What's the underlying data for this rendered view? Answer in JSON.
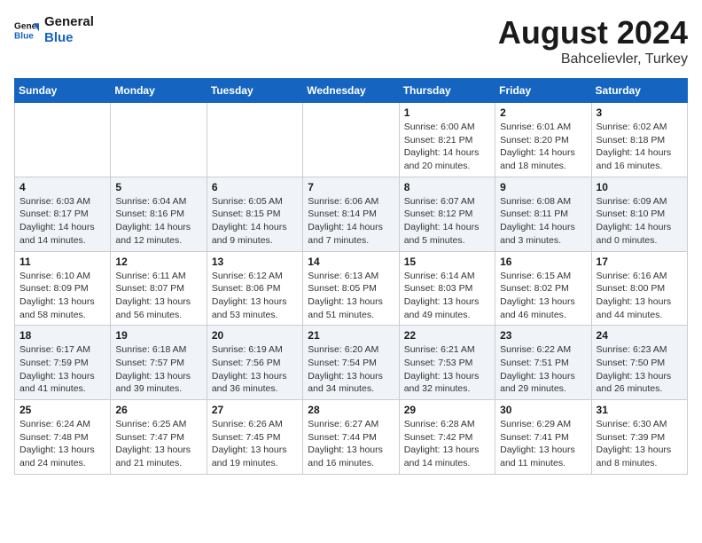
{
  "header": {
    "logo_line1": "General",
    "logo_line2": "Blue",
    "main_title": "August 2024",
    "subtitle": "Bahcelievler, Turkey"
  },
  "calendar": {
    "days_of_week": [
      "Sunday",
      "Monday",
      "Tuesday",
      "Wednesday",
      "Thursday",
      "Friday",
      "Saturday"
    ],
    "weeks": [
      {
        "days": [
          {
            "num": "",
            "detail": ""
          },
          {
            "num": "",
            "detail": ""
          },
          {
            "num": "",
            "detail": ""
          },
          {
            "num": "",
            "detail": ""
          },
          {
            "num": "1",
            "detail": "Sunrise: 6:00 AM\nSunset: 8:21 PM\nDaylight: 14 hours and 20 minutes."
          },
          {
            "num": "2",
            "detail": "Sunrise: 6:01 AM\nSunset: 8:20 PM\nDaylight: 14 hours and 18 minutes."
          },
          {
            "num": "3",
            "detail": "Sunrise: 6:02 AM\nSunset: 8:18 PM\nDaylight: 14 hours and 16 minutes."
          }
        ]
      },
      {
        "days": [
          {
            "num": "4",
            "detail": "Sunrise: 6:03 AM\nSunset: 8:17 PM\nDaylight: 14 hours and 14 minutes."
          },
          {
            "num": "5",
            "detail": "Sunrise: 6:04 AM\nSunset: 8:16 PM\nDaylight: 14 hours and 12 minutes."
          },
          {
            "num": "6",
            "detail": "Sunrise: 6:05 AM\nSunset: 8:15 PM\nDaylight: 14 hours and 9 minutes."
          },
          {
            "num": "7",
            "detail": "Sunrise: 6:06 AM\nSunset: 8:14 PM\nDaylight: 14 hours and 7 minutes."
          },
          {
            "num": "8",
            "detail": "Sunrise: 6:07 AM\nSunset: 8:12 PM\nDaylight: 14 hours and 5 minutes."
          },
          {
            "num": "9",
            "detail": "Sunrise: 6:08 AM\nSunset: 8:11 PM\nDaylight: 14 hours and 3 minutes."
          },
          {
            "num": "10",
            "detail": "Sunrise: 6:09 AM\nSunset: 8:10 PM\nDaylight: 14 hours and 0 minutes."
          }
        ]
      },
      {
        "days": [
          {
            "num": "11",
            "detail": "Sunrise: 6:10 AM\nSunset: 8:09 PM\nDaylight: 13 hours and 58 minutes."
          },
          {
            "num": "12",
            "detail": "Sunrise: 6:11 AM\nSunset: 8:07 PM\nDaylight: 13 hours and 56 minutes."
          },
          {
            "num": "13",
            "detail": "Sunrise: 6:12 AM\nSunset: 8:06 PM\nDaylight: 13 hours and 53 minutes."
          },
          {
            "num": "14",
            "detail": "Sunrise: 6:13 AM\nSunset: 8:05 PM\nDaylight: 13 hours and 51 minutes."
          },
          {
            "num": "15",
            "detail": "Sunrise: 6:14 AM\nSunset: 8:03 PM\nDaylight: 13 hours and 49 minutes."
          },
          {
            "num": "16",
            "detail": "Sunrise: 6:15 AM\nSunset: 8:02 PM\nDaylight: 13 hours and 46 minutes."
          },
          {
            "num": "17",
            "detail": "Sunrise: 6:16 AM\nSunset: 8:00 PM\nDaylight: 13 hours and 44 minutes."
          }
        ]
      },
      {
        "days": [
          {
            "num": "18",
            "detail": "Sunrise: 6:17 AM\nSunset: 7:59 PM\nDaylight: 13 hours and 41 minutes."
          },
          {
            "num": "19",
            "detail": "Sunrise: 6:18 AM\nSunset: 7:57 PM\nDaylight: 13 hours and 39 minutes."
          },
          {
            "num": "20",
            "detail": "Sunrise: 6:19 AM\nSunset: 7:56 PM\nDaylight: 13 hours and 36 minutes."
          },
          {
            "num": "21",
            "detail": "Sunrise: 6:20 AM\nSunset: 7:54 PM\nDaylight: 13 hours and 34 minutes."
          },
          {
            "num": "22",
            "detail": "Sunrise: 6:21 AM\nSunset: 7:53 PM\nDaylight: 13 hours and 32 minutes."
          },
          {
            "num": "23",
            "detail": "Sunrise: 6:22 AM\nSunset: 7:51 PM\nDaylight: 13 hours and 29 minutes."
          },
          {
            "num": "24",
            "detail": "Sunrise: 6:23 AM\nSunset: 7:50 PM\nDaylight: 13 hours and 26 minutes."
          }
        ]
      },
      {
        "days": [
          {
            "num": "25",
            "detail": "Sunrise: 6:24 AM\nSunset: 7:48 PM\nDaylight: 13 hours and 24 minutes."
          },
          {
            "num": "26",
            "detail": "Sunrise: 6:25 AM\nSunset: 7:47 PM\nDaylight: 13 hours and 21 minutes."
          },
          {
            "num": "27",
            "detail": "Sunrise: 6:26 AM\nSunset: 7:45 PM\nDaylight: 13 hours and 19 minutes."
          },
          {
            "num": "28",
            "detail": "Sunrise: 6:27 AM\nSunset: 7:44 PM\nDaylight: 13 hours and 16 minutes."
          },
          {
            "num": "29",
            "detail": "Sunrise: 6:28 AM\nSunset: 7:42 PM\nDaylight: 13 hours and 14 minutes."
          },
          {
            "num": "30",
            "detail": "Sunrise: 6:29 AM\nSunset: 7:41 PM\nDaylight: 13 hours and 11 minutes."
          },
          {
            "num": "31",
            "detail": "Sunrise: 6:30 AM\nSunset: 7:39 PM\nDaylight: 13 hours and 8 minutes."
          }
        ]
      }
    ]
  }
}
